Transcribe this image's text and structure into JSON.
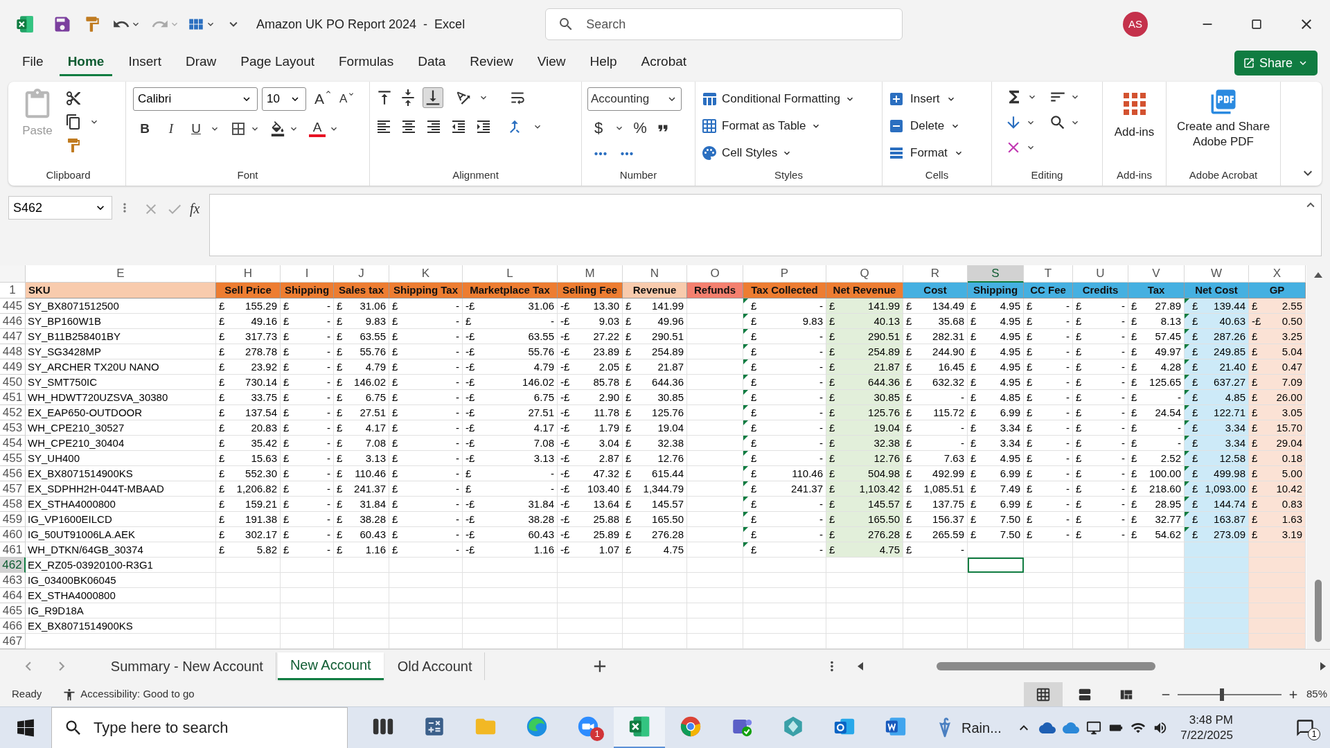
{
  "title_bar": {
    "title": "Amazon UK PO Report 2024  -  Excel",
    "search_placeholder": "Search",
    "avatar": "AS"
  },
  "menu_tabs": [
    {
      "label": "File",
      "selected": false
    },
    {
      "label": "Home",
      "selected": true
    },
    {
      "label": "Insert",
      "selected": false
    },
    {
      "label": "Draw",
      "selected": false
    },
    {
      "label": "Page Layout",
      "selected": false
    },
    {
      "label": "Formulas",
      "selected": false
    },
    {
      "label": "Data",
      "selected": false
    },
    {
      "label": "Review",
      "selected": false
    },
    {
      "label": "View",
      "selected": false
    },
    {
      "label": "Help",
      "selected": false
    },
    {
      "label": "Acrobat",
      "selected": false
    }
  ],
  "share_button": "Share",
  "ribbon": {
    "groups": [
      {
        "kind": "clipboard",
        "label": "Clipboard",
        "paste": "Paste"
      },
      {
        "kind": "font",
        "label": "Font",
        "family": "Calibri",
        "size": "10",
        "grow": "A",
        "shrink": "A",
        "bold": "B",
        "italic": "I",
        "underline": "U",
        "font_color": "A"
      },
      {
        "kind": "alignment",
        "label": "Alignment"
      },
      {
        "kind": "number",
        "label": "Number",
        "format": "Accounting",
        "currency": "$",
        "percent": "%"
      },
      {
        "kind": "styles",
        "label": "Styles",
        "buttons": [
          "Conditional Formatting",
          "Format as Table",
          "Cell Styles"
        ]
      },
      {
        "kind": "cells",
        "label": "Cells",
        "buttons": [
          "Insert",
          "Delete",
          "Format"
        ]
      },
      {
        "kind": "editing",
        "label": "Editing"
      },
      {
        "kind": "addins",
        "label": "Add-ins",
        "button": "Add-ins"
      },
      {
        "kind": "acrobat",
        "label": "Adobe Acrobat",
        "button": "Create and Share Adobe PDF"
      }
    ]
  },
  "formula_bar": {
    "name_box": "S462",
    "fx": "fx"
  },
  "columns": [
    {
      "letter": "E",
      "header": "SKU",
      "color": "#f8cbad",
      "selected": false
    },
    {
      "letter": "H",
      "header": "Sell Price",
      "color": "#ed7d31",
      "selected": false
    },
    {
      "letter": "I",
      "header": "Shipping",
      "color": "#ed7d31",
      "selected": false
    },
    {
      "letter": "J",
      "header": "Sales tax",
      "color": "#ed7d31",
      "selected": false
    },
    {
      "letter": "K",
      "header": "Shipping Tax",
      "color": "#ed7d31",
      "selected": false
    },
    {
      "letter": "L",
      "header": "Marketplace Tax",
      "color": "#ed7d31",
      "selected": false
    },
    {
      "letter": "M",
      "header": "Selling Fee",
      "color": "#ed7d31",
      "selected": false
    },
    {
      "letter": "N",
      "header": "Revenue",
      "color": "#f8cbad",
      "selected": false
    },
    {
      "letter": "O",
      "header": "Refunds",
      "color": "#f4806f",
      "selected": false
    },
    {
      "letter": "P",
      "header": "Tax Collected",
      "color": "#ed7d31",
      "flagged": true,
      "selected": false
    },
    {
      "letter": "Q",
      "header": "Net Revenue",
      "color": "#ed7d31",
      "body": {
        "color": "#e2efda"
      },
      "selected": false
    },
    {
      "letter": "R",
      "header": "Cost",
      "color": "#45b0e1",
      "selected": false
    },
    {
      "letter": "S",
      "header": "Shipping",
      "color": "#45b0e1",
      "selected": true
    },
    {
      "letter": "T",
      "header": "CC Fee",
      "color": "#45b0e1",
      "selected": false
    },
    {
      "letter": "U",
      "header": "Credits",
      "color": "#45b0e1",
      "selected": false
    },
    {
      "letter": "V",
      "header": "Tax",
      "color": "#45b0e1",
      "selected": false
    },
    {
      "letter": "W",
      "header": "Net Cost",
      "color": "#45b0e1",
      "body": {
        "color": "#cdeaf8",
        "fill_empty": true
      },
      "flagged": true,
      "selected": false
    },
    {
      "letter": "X",
      "header": "GP",
      "color": "#45b0e1",
      "body": {
        "color": "#fbe2d5",
        "fill_empty": true
      },
      "selected": false
    }
  ],
  "header_row_number": "1",
  "rows": [
    {
      "number": "445",
      "selected": false,
      "cells": [
        "SY_BX8071512500",
        [
          "£",
          "155.29"
        ],
        [
          "£",
          "-"
        ],
        [
          "£",
          "31.06"
        ],
        [
          "£",
          "-"
        ],
        [
          "-£",
          "31.06"
        ],
        [
          "-£",
          "13.30"
        ],
        [
          "£",
          "141.99"
        ],
        null,
        [
          "£",
          "-"
        ],
        [
          "£",
          "141.99"
        ],
        [
          "£",
          "134.49"
        ],
        [
          "£",
          "4.95"
        ],
        [
          "£",
          "-"
        ],
        [
          "£",
          "-"
        ],
        [
          "£",
          "27.89"
        ],
        [
          "£",
          "139.44"
        ],
        [
          "£",
          "2.55"
        ]
      ]
    },
    {
      "number": "446",
      "selected": false,
      "cells": [
        "SY_BP160W1B",
        [
          "£",
          "49.16"
        ],
        [
          "£",
          "-"
        ],
        [
          "£",
          "9.83"
        ],
        [
          "£",
          "-"
        ],
        [
          "£",
          "-"
        ],
        [
          "-£",
          "9.03"
        ],
        [
          "£",
          "49.96"
        ],
        null,
        [
          "£",
          "9.83"
        ],
        [
          "£",
          "40.13"
        ],
        [
          "£",
          "35.68"
        ],
        [
          "£",
          "4.95"
        ],
        [
          "£",
          "-"
        ],
        [
          "£",
          "-"
        ],
        [
          "£",
          "8.13"
        ],
        [
          "£",
          "40.63"
        ],
        [
          "-£",
          "0.50"
        ]
      ]
    },
    {
      "number": "447",
      "selected": false,
      "cells": [
        "SY_B11B258401BY",
        [
          "£",
          "317.73"
        ],
        [
          "£",
          "-"
        ],
        [
          "£",
          "63.55"
        ],
        [
          "£",
          "-"
        ],
        [
          "-£",
          "63.55"
        ],
        [
          "-£",
          "27.22"
        ],
        [
          "£",
          "290.51"
        ],
        null,
        [
          "£",
          "-"
        ],
        [
          "£",
          "290.51"
        ],
        [
          "£",
          "282.31"
        ],
        [
          "£",
          "4.95"
        ],
        [
          "£",
          "-"
        ],
        [
          "£",
          "-"
        ],
        [
          "£",
          "57.45"
        ],
        [
          "£",
          "287.26"
        ],
        [
          "£",
          "3.25"
        ]
      ]
    },
    {
      "number": "448",
      "selected": false,
      "cells": [
        "SY_SG3428MP",
        [
          "£",
          "278.78"
        ],
        [
          "£",
          "-"
        ],
        [
          "£",
          "55.76"
        ],
        [
          "£",
          "-"
        ],
        [
          "-£",
          "55.76"
        ],
        [
          "-£",
          "23.89"
        ],
        [
          "£",
          "254.89"
        ],
        null,
        [
          "£",
          "-"
        ],
        [
          "£",
          "254.89"
        ],
        [
          "£",
          "244.90"
        ],
        [
          "£",
          "4.95"
        ],
        [
          "£",
          "-"
        ],
        [
          "£",
          "-"
        ],
        [
          "£",
          "49.97"
        ],
        [
          "£",
          "249.85"
        ],
        [
          "£",
          "5.04"
        ]
      ]
    },
    {
      "number": "449",
      "selected": false,
      "cells": [
        "SY_ARCHER TX20U NANO",
        [
          "£",
          "23.92"
        ],
        [
          "£",
          "-"
        ],
        [
          "£",
          "4.79"
        ],
        [
          "£",
          "-"
        ],
        [
          "-£",
          "4.79"
        ],
        [
          "-£",
          "2.05"
        ],
        [
          "£",
          "21.87"
        ],
        null,
        [
          "£",
          "-"
        ],
        [
          "£",
          "21.87"
        ],
        [
          "£",
          "16.45"
        ],
        [
          "£",
          "4.95"
        ],
        [
          "£",
          "-"
        ],
        [
          "£",
          "-"
        ],
        [
          "£",
          "4.28"
        ],
        [
          "£",
          "21.40"
        ],
        [
          "£",
          "0.47"
        ]
      ]
    },
    {
      "number": "450",
      "selected": false,
      "cells": [
        "SY_SMT750IC",
        [
          "£",
          "730.14"
        ],
        [
          "£",
          "-"
        ],
        [
          "£",
          "146.02"
        ],
        [
          "£",
          "-"
        ],
        [
          "-£",
          "146.02"
        ],
        [
          "-£",
          "85.78"
        ],
        [
          "£",
          "644.36"
        ],
        null,
        [
          "£",
          "-"
        ],
        [
          "£",
          "644.36"
        ],
        [
          "£",
          "632.32"
        ],
        [
          "£",
          "4.95"
        ],
        [
          "£",
          "-"
        ],
        [
          "£",
          "-"
        ],
        [
          "£",
          "125.65"
        ],
        [
          "£",
          "637.27"
        ],
        [
          "£",
          "7.09"
        ]
      ]
    },
    {
      "number": "451",
      "selected": false,
      "cells": [
        "WH_HDWT720UZSVA_30380",
        [
          "£",
          "33.75"
        ],
        [
          "£",
          "-"
        ],
        [
          "£",
          "6.75"
        ],
        [
          "£",
          "-"
        ],
        [
          "-£",
          "6.75"
        ],
        [
          "-£",
          "2.90"
        ],
        [
          "£",
          "30.85"
        ],
        null,
        [
          "£",
          "-"
        ],
        [
          "£",
          "30.85"
        ],
        [
          "£",
          "-"
        ],
        [
          "£",
          "4.85"
        ],
        [
          "£",
          "-"
        ],
        [
          "£",
          "-"
        ],
        [
          "£",
          "-"
        ],
        [
          "£",
          "4.85"
        ],
        [
          "£",
          "26.00"
        ]
      ]
    },
    {
      "number": "452",
      "selected": false,
      "cells": [
        "EX_EAP650-OUTDOOR",
        [
          "£",
          "137.54"
        ],
        [
          "£",
          "-"
        ],
        [
          "£",
          "27.51"
        ],
        [
          "£",
          "-"
        ],
        [
          "-£",
          "27.51"
        ],
        [
          "-£",
          "11.78"
        ],
        [
          "£",
          "125.76"
        ],
        null,
        [
          "£",
          "-"
        ],
        [
          "£",
          "125.76"
        ],
        [
          "£",
          "115.72"
        ],
        [
          "£",
          "6.99"
        ],
        [
          "£",
          "-"
        ],
        [
          "£",
          "-"
        ],
        [
          "£",
          "24.54"
        ],
        [
          "£",
          "122.71"
        ],
        [
          "£",
          "3.05"
        ]
      ]
    },
    {
      "number": "453",
      "selected": false,
      "cells": [
        "WH_CPE210_30527",
        [
          "£",
          "20.83"
        ],
        [
          "£",
          "-"
        ],
        [
          "£",
          "4.17"
        ],
        [
          "£",
          "-"
        ],
        [
          "-£",
          "4.17"
        ],
        [
          "-£",
          "1.79"
        ],
        [
          "£",
          "19.04"
        ],
        null,
        [
          "£",
          "-"
        ],
        [
          "£",
          "19.04"
        ],
        [
          "£",
          "-"
        ],
        [
          "£",
          "3.34"
        ],
        [
          "£",
          "-"
        ],
        [
          "£",
          "-"
        ],
        [
          "£",
          "-"
        ],
        [
          "£",
          "3.34"
        ],
        [
          "£",
          "15.70"
        ]
      ]
    },
    {
      "number": "454",
      "selected": false,
      "cells": [
        "WH_CPE210_30404",
        [
          "£",
          "35.42"
        ],
        [
          "£",
          "-"
        ],
        [
          "£",
          "7.08"
        ],
        [
          "£",
          "-"
        ],
        [
          "-£",
          "7.08"
        ],
        [
          "-£",
          "3.04"
        ],
        [
          "£",
          "32.38"
        ],
        null,
        [
          "£",
          "-"
        ],
        [
          "£",
          "32.38"
        ],
        [
          "£",
          "-"
        ],
        [
          "£",
          "3.34"
        ],
        [
          "£",
          "-"
        ],
        [
          "£",
          "-"
        ],
        [
          "£",
          "-"
        ],
        [
          "£",
          "3.34"
        ],
        [
          "£",
          "29.04"
        ]
      ]
    },
    {
      "number": "455",
      "selected": false,
      "cells": [
        "SY_UH400",
        [
          "£",
          "15.63"
        ],
        [
          "£",
          "-"
        ],
        [
          "£",
          "3.13"
        ],
        [
          "£",
          "-"
        ],
        [
          "-£",
          "3.13"
        ],
        [
          "-£",
          "2.87"
        ],
        [
          "£",
          "12.76"
        ],
        null,
        [
          "£",
          "-"
        ],
        [
          "£",
          "12.76"
        ],
        [
          "£",
          "7.63"
        ],
        [
          "£",
          "4.95"
        ],
        [
          "£",
          "-"
        ],
        [
          "£",
          "-"
        ],
        [
          "£",
          "2.52"
        ],
        [
          "£",
          "12.58"
        ],
        [
          "£",
          "0.18"
        ]
      ]
    },
    {
      "number": "456",
      "selected": false,
      "cells": [
        "EX_BX8071514900KS",
        [
          "£",
          "552.30"
        ],
        [
          "£",
          "-"
        ],
        [
          "£",
          "110.46"
        ],
        [
          "£",
          "-"
        ],
        [
          "£",
          "-"
        ],
        [
          "-£",
          "47.32"
        ],
        [
          "£",
          "615.44"
        ],
        null,
        [
          "£",
          "110.46"
        ],
        [
          "£",
          "504.98"
        ],
        [
          "£",
          "492.99"
        ],
        [
          "£",
          "6.99"
        ],
        [
          "£",
          "-"
        ],
        [
          "£",
          "-"
        ],
        [
          "£",
          "100.00"
        ],
        [
          "£",
          "499.98"
        ],
        [
          "£",
          "5.00"
        ]
      ]
    },
    {
      "number": "457",
      "selected": false,
      "cells": [
        "EX_SDPHH2H-044T-MBAAD",
        [
          "£",
          "1,206.82"
        ],
        [
          "£",
          "-"
        ],
        [
          "£",
          "241.37"
        ],
        [
          "£",
          "-"
        ],
        [
          "£",
          "-"
        ],
        [
          "-£",
          "103.40"
        ],
        [
          "£",
          "1,344.79"
        ],
        null,
        [
          "£",
          "241.37"
        ],
        [
          "£",
          "1,103.42"
        ],
        [
          "£",
          "1,085.51"
        ],
        [
          "£",
          "7.49"
        ],
        [
          "£",
          "-"
        ],
        [
          "£",
          "-"
        ],
        [
          "£",
          "218.60"
        ],
        [
          "£",
          "1,093.00"
        ],
        [
          "£",
          "10.42"
        ]
      ]
    },
    {
      "number": "458",
      "selected": false,
      "cells": [
        "EX_STHA4000800",
        [
          "£",
          "159.21"
        ],
        [
          "£",
          "-"
        ],
        [
          "£",
          "31.84"
        ],
        [
          "£",
          "-"
        ],
        [
          "-£",
          "31.84"
        ],
        [
          "-£",
          "13.64"
        ],
        [
          "£",
          "145.57"
        ],
        null,
        [
          "£",
          "-"
        ],
        [
          "£",
          "145.57"
        ],
        [
          "£",
          "137.75"
        ],
        [
          "£",
          "6.99"
        ],
        [
          "£",
          "-"
        ],
        [
          "£",
          "-"
        ],
        [
          "£",
          "28.95"
        ],
        [
          "£",
          "144.74"
        ],
        [
          "£",
          "0.83"
        ]
      ]
    },
    {
      "number": "459",
      "selected": false,
      "cells": [
        "IG_VP1600EILCD",
        [
          "£",
          "191.38"
        ],
        [
          "£",
          "-"
        ],
        [
          "£",
          "38.28"
        ],
        [
          "£",
          "-"
        ],
        [
          "-£",
          "38.28"
        ],
        [
          "-£",
          "25.88"
        ],
        [
          "£",
          "165.50"
        ],
        null,
        [
          "£",
          "-"
        ],
        [
          "£",
          "165.50"
        ],
        [
          "£",
          "156.37"
        ],
        [
          "£",
          "7.50"
        ],
        [
          "£",
          "-"
        ],
        [
          "£",
          "-"
        ],
        [
          "£",
          "32.77"
        ],
        [
          "£",
          "163.87"
        ],
        [
          "£",
          "1.63"
        ]
      ]
    },
    {
      "number": "460",
      "selected": false,
      "cells": [
        "IG_50UT91006LA.AEK",
        [
          "£",
          "302.17"
        ],
        [
          "£",
          "-"
        ],
        [
          "£",
          "60.43"
        ],
        [
          "£",
          "-"
        ],
        [
          "-£",
          "60.43"
        ],
        [
          "-£",
          "25.89"
        ],
        [
          "£",
          "276.28"
        ],
        null,
        [
          "£",
          "-"
        ],
        [
          "£",
          "276.28"
        ],
        [
          "£",
          "265.59"
        ],
        [
          "£",
          "7.50"
        ],
        [
          "£",
          "-"
        ],
        [
          "£",
          "-"
        ],
        [
          "£",
          "54.62"
        ],
        [
          "£",
          "273.09"
        ],
        [
          "£",
          "3.19"
        ]
      ]
    },
    {
      "number": "461",
      "selected": false,
      "cells": [
        "WH_DTKN/64GB_30374",
        [
          "£",
          "5.82"
        ],
        [
          "£",
          "-"
        ],
        [
          "£",
          "1.16"
        ],
        [
          "£",
          "-"
        ],
        [
          "-£",
          "1.16"
        ],
        [
          "-£",
          "1.07"
        ],
        [
          "£",
          "4.75"
        ],
        null,
        [
          "£",
          "-"
        ],
        [
          "£",
          "4.75"
        ],
        [
          "£",
          "-"
        ],
        null,
        null,
        null,
        null,
        null,
        null
      ]
    },
    {
      "number": "462",
      "selected": true,
      "cells": [
        "EX_RZ05-03920100-R3G1",
        null,
        null,
        null,
        null,
        null,
        null,
        null,
        null,
        null,
        null,
        null,
        null,
        null,
        null,
        null,
        null,
        null
      ]
    },
    {
      "number": "463",
      "selected": false,
      "cells": [
        "IG_03400BK06045",
        null,
        null,
        null,
        null,
        null,
        null,
        null,
        null,
        null,
        null,
        null,
        null,
        null,
        null,
        null,
        null,
        null
      ]
    },
    {
      "number": "464",
      "selected": false,
      "cells": [
        "EX_STHA4000800",
        null,
        null,
        null,
        null,
        null,
        null,
        null,
        null,
        null,
        null,
        null,
        null,
        null,
        null,
        null,
        null,
        null
      ]
    },
    {
      "number": "465",
      "selected": false,
      "cells": [
        "IG_R9D18A",
        null,
        null,
        null,
        null,
        null,
        null,
        null,
        null,
        null,
        null,
        null,
        null,
        null,
        null,
        null,
        null,
        null
      ]
    },
    {
      "number": "466",
      "selected": false,
      "cells": [
        "EX_BX8071514900KS",
        null,
        null,
        null,
        null,
        null,
        null,
        null,
        null,
        null,
        null,
        null,
        null,
        null,
        null,
        null,
        null,
        null
      ]
    },
    {
      "number": "467",
      "selected": false,
      "cells": [
        null,
        null,
        null,
        null,
        null,
        null,
        null,
        null,
        null,
        null,
        null,
        null,
        null,
        null,
        null,
        null,
        null,
        null
      ]
    }
  ],
  "sheet_tabs": [
    {
      "label": "Summary - New Account",
      "selected": false
    },
    {
      "label": "New Account",
      "selected": true
    },
    {
      "label": "Old Account",
      "selected": false
    }
  ],
  "status_bar": {
    "status": "Ready",
    "accessibility": "Accessibility: Good to go",
    "views": [
      {
        "kind": "normal",
        "selected": true
      },
      {
        "kind": "page-layout",
        "selected": false
      },
      {
        "kind": "page-break",
        "selected": false
      }
    ],
    "zoom": {
      "level": 0.43,
      "reading": "85%"
    }
  },
  "taskbar": {
    "search_placeholder": "Type here to search",
    "apps": [
      {
        "kind": "task-view",
        "active": false
      },
      {
        "kind": "calculator",
        "active": false
      },
      {
        "kind": "file-explorer",
        "active": false
      },
      {
        "kind": "edge",
        "active": false
      },
      {
        "kind": "zoom",
        "active": false,
        "badge": "1"
      },
      {
        "kind": "excel",
        "active": true
      },
      {
        "kind": "chrome",
        "active": false
      },
      {
        "kind": "teams",
        "active": false
      },
      {
        "kind": "app",
        "active": false
      },
      {
        "kind": "outlook",
        "active": false
      },
      {
        "kind": "word",
        "active": false
      }
    ],
    "weather": "Rain...",
    "time": "3:48 PM",
    "date": "7/22/2025",
    "notifications": "1"
  }
}
